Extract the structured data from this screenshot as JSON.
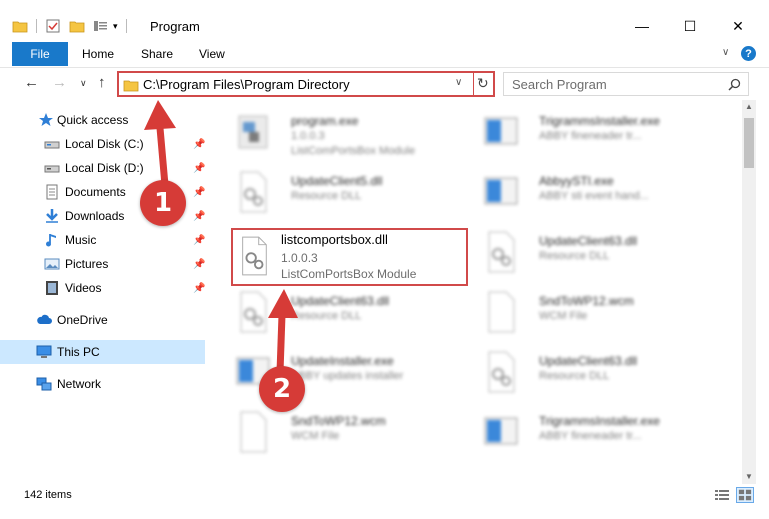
{
  "window": {
    "title": "Program",
    "minimize": "—",
    "maximize": "☐",
    "close": "✕"
  },
  "ribbon": {
    "tabs": [
      "File",
      "Home",
      "Share",
      "View"
    ],
    "help": "?"
  },
  "address": {
    "path": "C:\\Program Files\\Program Directory",
    "search_placeholder": "Search Program"
  },
  "sidebar": {
    "items": [
      {
        "label": "Quick access",
        "icon": "star-icon"
      },
      {
        "label": "Local Disk (C:)",
        "icon": "drive-icon"
      },
      {
        "label": "Local Disk (D:)",
        "icon": "drive-icon"
      },
      {
        "label": "Documents",
        "icon": "documents-icon"
      },
      {
        "label": "Downloads",
        "icon": "download-icon"
      },
      {
        "label": "Music",
        "icon": "music-icon"
      },
      {
        "label": "Pictures",
        "icon": "pictures-icon"
      },
      {
        "label": "Videos",
        "icon": "videos-icon"
      },
      {
        "label": "OneDrive",
        "icon": "cloud-icon"
      },
      {
        "label": "This PC",
        "icon": "computer-icon"
      },
      {
        "label": "Network",
        "icon": "network-icon"
      }
    ]
  },
  "files": [
    {
      "name": "program.exe",
      "line2": "1.0.0.3",
      "line3": "ListComPortsBox Module",
      "icon": "exe-icon"
    },
    {
      "name": "TrigrammsInstaller.exe",
      "line2": "ABBY fineneader tr...",
      "line3": "",
      "icon": "installer-icon"
    },
    {
      "name": "UpdateClient5.dll",
      "line2": "Resource DLL",
      "line3": "",
      "icon": "dll-icon"
    },
    {
      "name": "AbbyySTI.exe",
      "line2": "ABBY sti event hand...",
      "line3": "",
      "icon": "installer-icon"
    },
    {
      "name": "listcomportsbox.dll",
      "line2": "1.0.0.3",
      "line3": "ListComPortsBox Module",
      "icon": "dll-icon"
    },
    {
      "name": "UpdateClient63.dll",
      "line2": "Resource DLL",
      "line3": "",
      "icon": "dll-icon"
    },
    {
      "name": "UpdateClient63.dll",
      "line2": "Resource DLL",
      "line3": "",
      "icon": "dll-icon"
    },
    {
      "name": "SndToWP12.wcm",
      "line2": "WCM File",
      "line3": "",
      "icon": "file-icon"
    },
    {
      "name": "UpdateInstaller.exe",
      "line2": "ABBY updates installer",
      "line3": "",
      "icon": "installer-icon"
    },
    {
      "name": "UpdateClient63.dll",
      "line2": "Resource DLL",
      "line3": "",
      "icon": "dll-icon"
    },
    {
      "name": "SndToWP12.wcm",
      "line2": "WCM File",
      "line3": "",
      "icon": "file-icon"
    },
    {
      "name": "TrigrammsInstaller.exe",
      "line2": "ABBY fineneader tr...",
      "line3": "",
      "icon": "installer-icon"
    }
  ],
  "status": {
    "count": "142 items"
  },
  "annotations": [
    "1",
    "2"
  ],
  "colors": {
    "accent": "#1979ca",
    "highlight": "#d14a4a",
    "badge": "#d63b37",
    "selected": "#cce8ff"
  }
}
